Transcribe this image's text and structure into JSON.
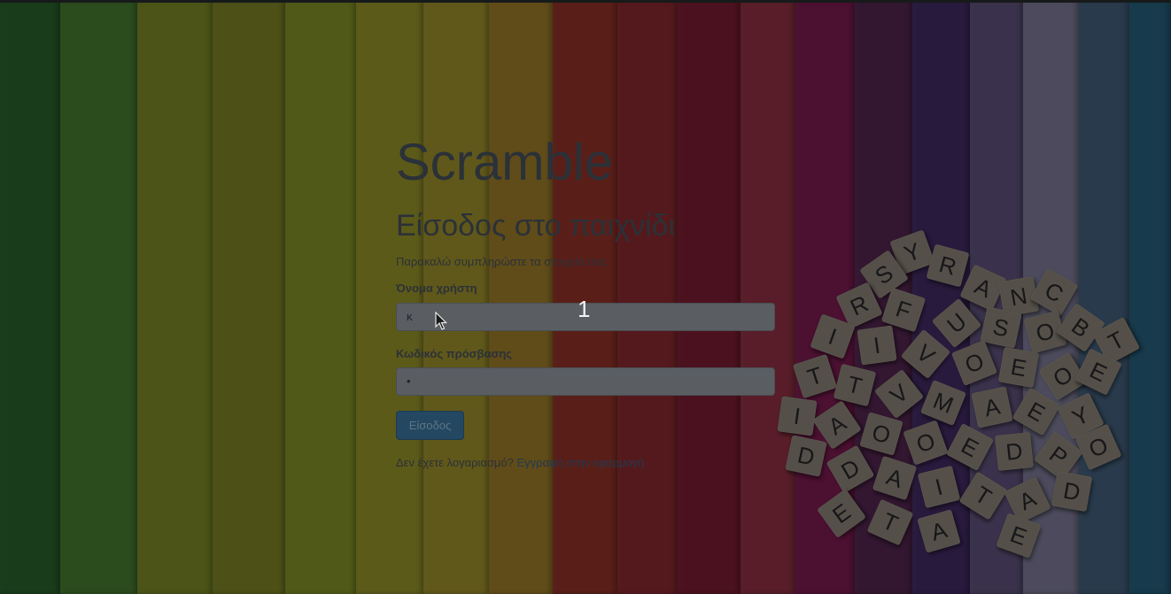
{
  "app": {
    "title": "Scramble",
    "subtitle": "Είσοδος στο παιχνίδι",
    "instructions": "Παρακαλώ συμπληρώστε τα στοιχεία σας"
  },
  "form": {
    "username_label": "Όνομα χρήστη",
    "username_value": "κ",
    "password_label": "Κωδικός πρόσβασης",
    "password_value": "•",
    "submit_label": "Είσοδος"
  },
  "footer": {
    "prompt": "Δεν έχετε λογαριασμό?",
    "register_link": "Εγγραφή στην εφαρμογή"
  },
  "overlay": {
    "step_number": "1"
  },
  "background": {
    "stripe_colors": [
      "#2e6e30",
      "#4f8a36",
      "#8a9a2c",
      "#8c922a",
      "#93a22c",
      "#a8a52e",
      "#b0a030",
      "#b08a2e",
      "#a2382c",
      "#9a2e34",
      "#8a2038",
      "#a0364a",
      "#8a1e5a",
      "#5e2a5a",
      "#4a3070",
      "#6a5c8a",
      "#8a88a8",
      "#4a6a8a",
      "#2a6a8a"
    ],
    "tile_letters": [
      "Y",
      "R",
      "S",
      "A",
      "N",
      "C",
      "R",
      "F",
      "U",
      "S",
      "O",
      "B",
      "T",
      "I",
      "I",
      "V",
      "O",
      "E",
      "O",
      "E",
      "T",
      "T",
      "V",
      "M",
      "A",
      "E",
      "Y",
      "I",
      "A",
      "O",
      "O",
      "E",
      "D",
      "P",
      "O",
      "D",
      "D",
      "A",
      "I",
      "T",
      "A",
      "D",
      "E",
      "T",
      "A",
      "E"
    ]
  }
}
